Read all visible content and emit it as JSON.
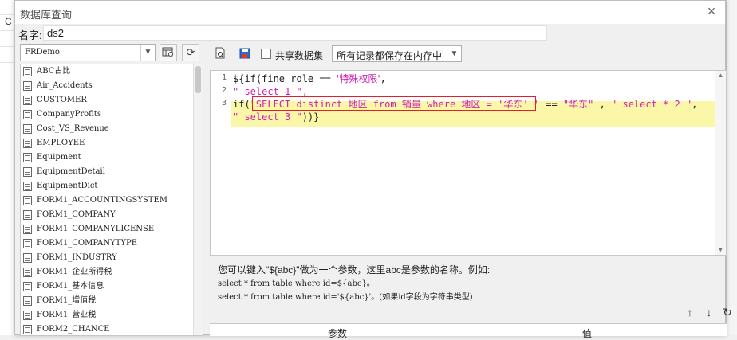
{
  "background": {
    "cell_text": "C"
  },
  "dialog": {
    "title": "数据库查询",
    "close_glyph": "×",
    "name_label": "名字:",
    "name_value": "ds2"
  },
  "left": {
    "datasource": "FRDemo",
    "tables": [
      "ABC占比",
      "Air_Accidents",
      "CUSTOMER",
      "CompanyProfits",
      "Cost_VS_Revenue",
      "EMPLOYEE",
      "Equipment",
      "EquipmentDetail",
      "EquipmentDict",
      "FORM1_ACCOUNTINGSYSTEM",
      "FORM1_COMPANY",
      "FORM1_COMPANYLICENSE",
      "FORM1_COMPANYTYPE",
      "FORM1_INDUSTRY",
      "FORM1_企业所得税",
      "FORM1_基本信息",
      "FORM1_增值税",
      "FORM1_营业税",
      "FORM2_CHANCE"
    ]
  },
  "right": {
    "share_label": "共享数据集",
    "store_option": "所有记录都保存在内存中",
    "line_numbers": [
      "1",
      "2",
      "3"
    ],
    "code": {
      "l1a": "${if(fine_role == ",
      "l1b": "'特殊权限'",
      "l1c": ",",
      "l2": "\" select 1 \",",
      "l3a": "if(",
      "l3b": "\"SELECT distinct 地区 from 销量 where 地区 = '华东' \"",
      "l3c": " == ",
      "l3d": "\"华东\"",
      "l3e": " , ",
      "l3f": "\" select * 2 \"",
      "l3g": ",",
      "l4a": "\" select 3 \"",
      "l4b": "))}"
    },
    "hint": {
      "line1": "您可以键入\"${abc}\"做为一个参数，这里abc是参数的名称。例如:",
      "line2": "select * from table where id=${abc}。",
      "line3": "select * from table where id='${abc}'。(如果id字段为字符串类型)"
    },
    "param_col": "参数",
    "value_col": "值"
  },
  "colors": {
    "string": "#d21fb3",
    "highlight": "#fbf7a8",
    "annotation_box": "#e0202a"
  }
}
